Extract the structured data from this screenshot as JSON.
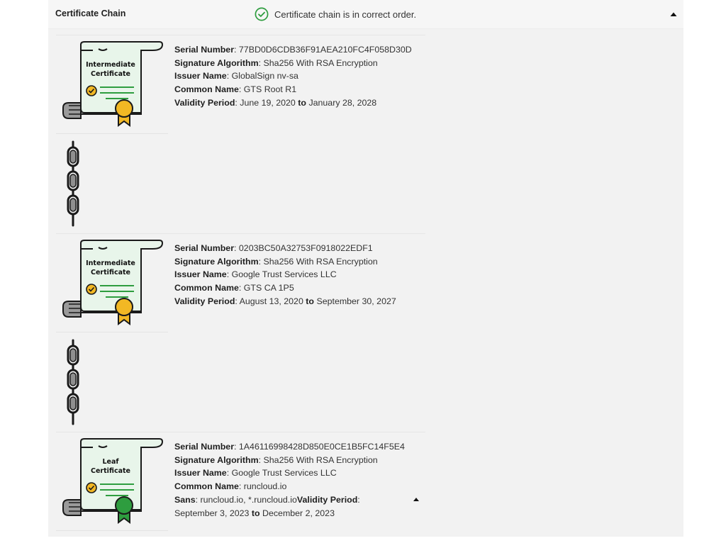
{
  "header": {
    "title": "Certificate Chain",
    "status_text": "Certificate chain is in correct order.",
    "status_color": "#2e9d3f"
  },
  "certificates": [
    {
      "label_line1": "Intermediate",
      "label_line2": "Certificate",
      "seal_color": "#f2b824",
      "serial_label": "Serial Number",
      "serial": "77BD0D6CDB36F91AEA210FC4F058D30D",
      "algo_label": "Signature Algorithm",
      "algo": "Sha256 With RSA Encryption",
      "issuer_label": "Issuer Name",
      "issuer": "GlobalSign nv-sa",
      "cn_label": "Common Name",
      "cn": "GTS Root R1",
      "validity_label": "Validity Period",
      "valid_from": "June 19, 2020",
      "to_word": "to",
      "valid_to": "January 28, 2028"
    },
    {
      "label_line1": "Intermediate",
      "label_line2": "Certificate",
      "seal_color": "#f2b824",
      "serial_label": "Serial Number",
      "serial": "0203BC50A32753F0918022EDF1",
      "algo_label": "Signature Algorithm",
      "algo": "Sha256 With RSA Encryption",
      "issuer_label": "Issuer Name",
      "issuer": "Google Trust Services LLC",
      "cn_label": "Common Name",
      "cn": "GTS CA 1P5",
      "validity_label": "Validity Period",
      "valid_from": "August 13, 2020",
      "to_word": "to",
      "valid_to": "September 30, 2027"
    },
    {
      "label_line1": "Leaf",
      "label_line2": "Certificate",
      "seal_color": "#2e9d3f",
      "serial_label": "Serial Number",
      "serial": "1A46116998428D850E0CE1B5FC14F5E4",
      "algo_label": "Signature Algorithm",
      "algo": "Sha256 With RSA Encryption",
      "issuer_label": "Issuer Name",
      "issuer": "Google Trust Services LLC",
      "cn_label": "Common Name",
      "cn": "runcloud.io",
      "sans_label": "Sans",
      "sans": "runcloud.io, *.runcloud.io",
      "validity_label": "Validity Period",
      "valid_from": "September 3, 2023",
      "to_word": "to",
      "valid_to": "December 2, 2023"
    }
  ],
  "icons": {
    "status": "check-circle-icon",
    "collapse": "caret-up-icon",
    "chain": "chain-link-icon"
  }
}
